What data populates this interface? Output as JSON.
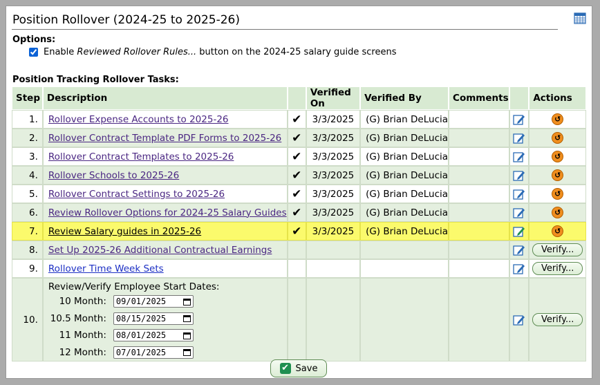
{
  "title": "Position Rollover (2024-25 to 2025-26)",
  "options": {
    "heading": "Options:",
    "enable_prefix": "Enable ",
    "enable_italic": "Reviewed Rollover Rules...",
    "enable_suffix": " button on the 2024-25 salary guide screens",
    "checked": true
  },
  "tasks_heading": "Position Tracking Rollover Tasks:",
  "columns": [
    "Step",
    "Description",
    "Verified On",
    "Verified By",
    "Comments",
    "Actions"
  ],
  "rows": [
    {
      "step": "1.",
      "desc": "Rollover Expense Accounts to 2025-26",
      "verified": true,
      "on": "3/3/2025",
      "by": "(G) Brian DeLucia"
    },
    {
      "step": "2.",
      "desc": "Rollover Contract Template PDF Forms to 2025-26",
      "verified": true,
      "on": "3/3/2025",
      "by": "(G) Brian DeLucia"
    },
    {
      "step": "3.",
      "desc": "Rollover Contract Templates to 2025-26",
      "verified": true,
      "on": "3/3/2025",
      "by": "(G) Brian DeLucia"
    },
    {
      "step": "4.",
      "desc": "Rollover Schools to 2025-26",
      "verified": true,
      "on": "3/3/2025",
      "by": "(G) Brian DeLucia"
    },
    {
      "step": "5.",
      "desc": "Rollover Contract Settings to 2025-26",
      "verified": true,
      "on": "3/3/2025",
      "by": "(G) Brian DeLucia"
    },
    {
      "step": "6.",
      "desc": "Review Rollover Options for 2024-25 Salary Guides",
      "verified": true,
      "on": "3/3/2025",
      "by": "(G) Brian DeLucia"
    },
    {
      "step": "7.",
      "desc": "Review Salary guides in 2025-26",
      "verified": true,
      "on": "3/3/2025",
      "by": "(G) Brian DeLucia"
    },
    {
      "step": "8.",
      "desc": "Set Up 2025-26 Additional Contractual Earnings",
      "verified": false,
      "action": "Verify..."
    },
    {
      "step": "9.",
      "desc": "Rollover Time Week Sets",
      "verified": false,
      "action": "Verify..."
    }
  ],
  "row10": {
    "step": "10.",
    "heading": "Review/Verify Employee Start Dates:",
    "dates": [
      {
        "label": "10 Month:",
        "value": "09/01/2025"
      },
      {
        "label": "10.5 Month:",
        "value": "08/15/2025"
      },
      {
        "label": "11 Month:",
        "value": "08/01/2025"
      },
      {
        "label": "12 Month:",
        "value": "07/01/2025"
      }
    ],
    "action": "Verify..."
  },
  "checkmark": "✔",
  "undo_glyph": "↺",
  "save_label": "Save",
  "colors": {
    "header_bg": "#d8ead2",
    "alt_row": "#e4efdf",
    "highlight": "#fbfa6c",
    "undo": "#f08e1e",
    "save_check": "#1f8f50"
  }
}
